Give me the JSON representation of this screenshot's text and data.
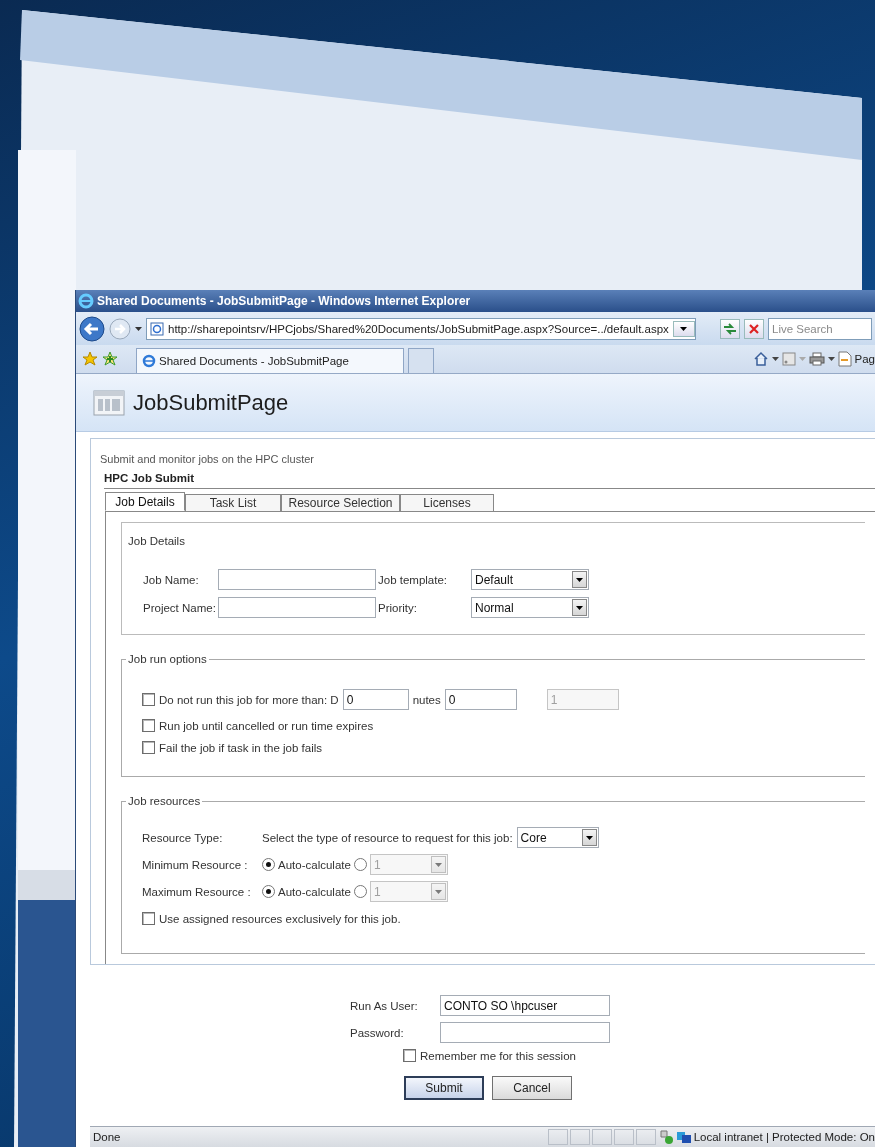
{
  "browser": {
    "title": "Shared Documents - JobSubmitPage - Windows Internet Explorer",
    "address": "http://sharepointsrv/HPCjobs/Shared%20Documents/JobSubmitPage.aspx?Source=../default.aspx",
    "search": {
      "placeholder": "Live Search"
    },
    "tabs": [
      {
        "label": "Shared Documents - JobSubmitPage",
        "selected": true
      }
    ],
    "page_menu": "Pag"
  },
  "page": {
    "title": "JobSubmitPage",
    "description": "Submit and monitor jobs on the HPC cluster",
    "webpart_title": "HPC Job Submit"
  },
  "tabs": [
    {
      "label": "Job Details",
      "selected": true
    },
    {
      "label": "Task List",
      "selected": false
    },
    {
      "label": "Resource Selection",
      "selected": false
    },
    {
      "label": "Licenses",
      "selected": false
    }
  ],
  "job_details": {
    "legend": "Job Details",
    "fields": [
      {
        "label": "Job Name:",
        "kind": "text"
      },
      {
        "label": "Job template:",
        "kind": "select",
        "value": "Default"
      },
      {
        "label": "Project Name:",
        "kind": "text"
      },
      {
        "label": "Priority:",
        "kind": "select",
        "value": "Normal"
      }
    ]
  },
  "run_options": {
    "legend": "Job run options",
    "items": [
      {
        "label": "Do not run this job for more than: D",
        "checked": false,
        "inputs": [
          {
            "value": "0",
            "disabled": false,
            "after": "nutes"
          },
          {
            "value": "0",
            "disabled": false
          },
          {
            "value": "1",
            "disabled": true
          }
        ]
      },
      {
        "label": "Run job until cancelled or run time expires",
        "checked": false
      },
      {
        "label": "Fail the job if task in the job fails",
        "checked": false
      }
    ]
  },
  "resources": {
    "legend": "Job resources",
    "type_label": "Resource Type:",
    "type_prompt": "Select the type of resource to request for this job:",
    "type_value": "Core",
    "rows": [
      {
        "label": "Minimum Resource :",
        "options": [
          {
            "label": "Auto-calculate",
            "selected": true
          },
          {
            "selected": false
          }
        ],
        "value": "1",
        "disabled": true
      },
      {
        "label": "Maximum Resource :",
        "options": [
          {
            "label": "Auto-calculate",
            "selected": true
          },
          {
            "selected": false
          }
        ],
        "value": "1",
        "disabled": true
      }
    ],
    "exclusive": {
      "label": "Use assigned resources exclusively for this job.",
      "checked": false
    }
  },
  "login": {
    "user_label": "Run As User:",
    "user_value": "CONTO SO \\hpcuser",
    "password_label": "Password:",
    "remember": {
      "label": "Remember me for this session",
      "checked": false
    },
    "buttons": [
      "Submit",
      "Cancel"
    ]
  },
  "status_bar": {
    "text": "Done",
    "zone": "Local intranet | Protected Mode: On"
  }
}
